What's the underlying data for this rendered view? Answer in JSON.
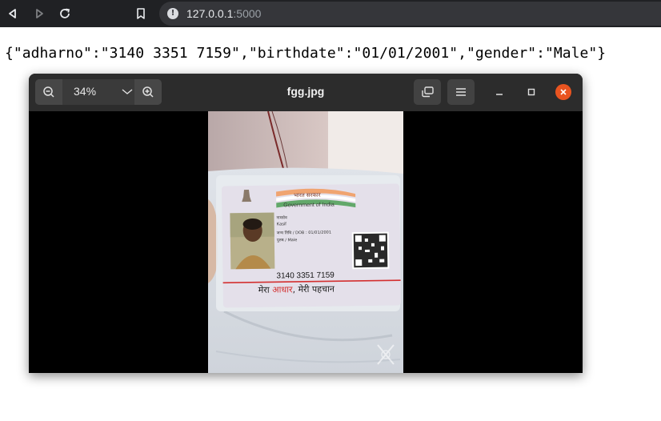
{
  "browser": {
    "url_host": "127.0.0.1",
    "url_port": ":5000"
  },
  "page": {
    "json_text": "{\"adharno\":\"3140 3351 7159\",\"birthdate\":\"01/01/2001\",\"gender\":\"Male\"}"
  },
  "viewer": {
    "title": "fgg.jpg",
    "zoom": "34%"
  },
  "card": {
    "header_hindi": "भारत सरकार",
    "header_english": "Government of India",
    "name_label": "नामसेव",
    "name": "Kasif",
    "dob_line": "जन्म तिथि / DOB : 01/01/2001",
    "gender_line": "पुरुष / Male",
    "number": "3140 3351 7159",
    "slogan_part1": "मेरा ",
    "slogan_highlight": "आधार",
    "slogan_part2": ", मेरी पहचान"
  },
  "colors": {
    "browser_bar": "#202124",
    "viewer_header": "#2c2c2c",
    "close_button": "#e95420",
    "card_red_line": "#d32f2f"
  }
}
